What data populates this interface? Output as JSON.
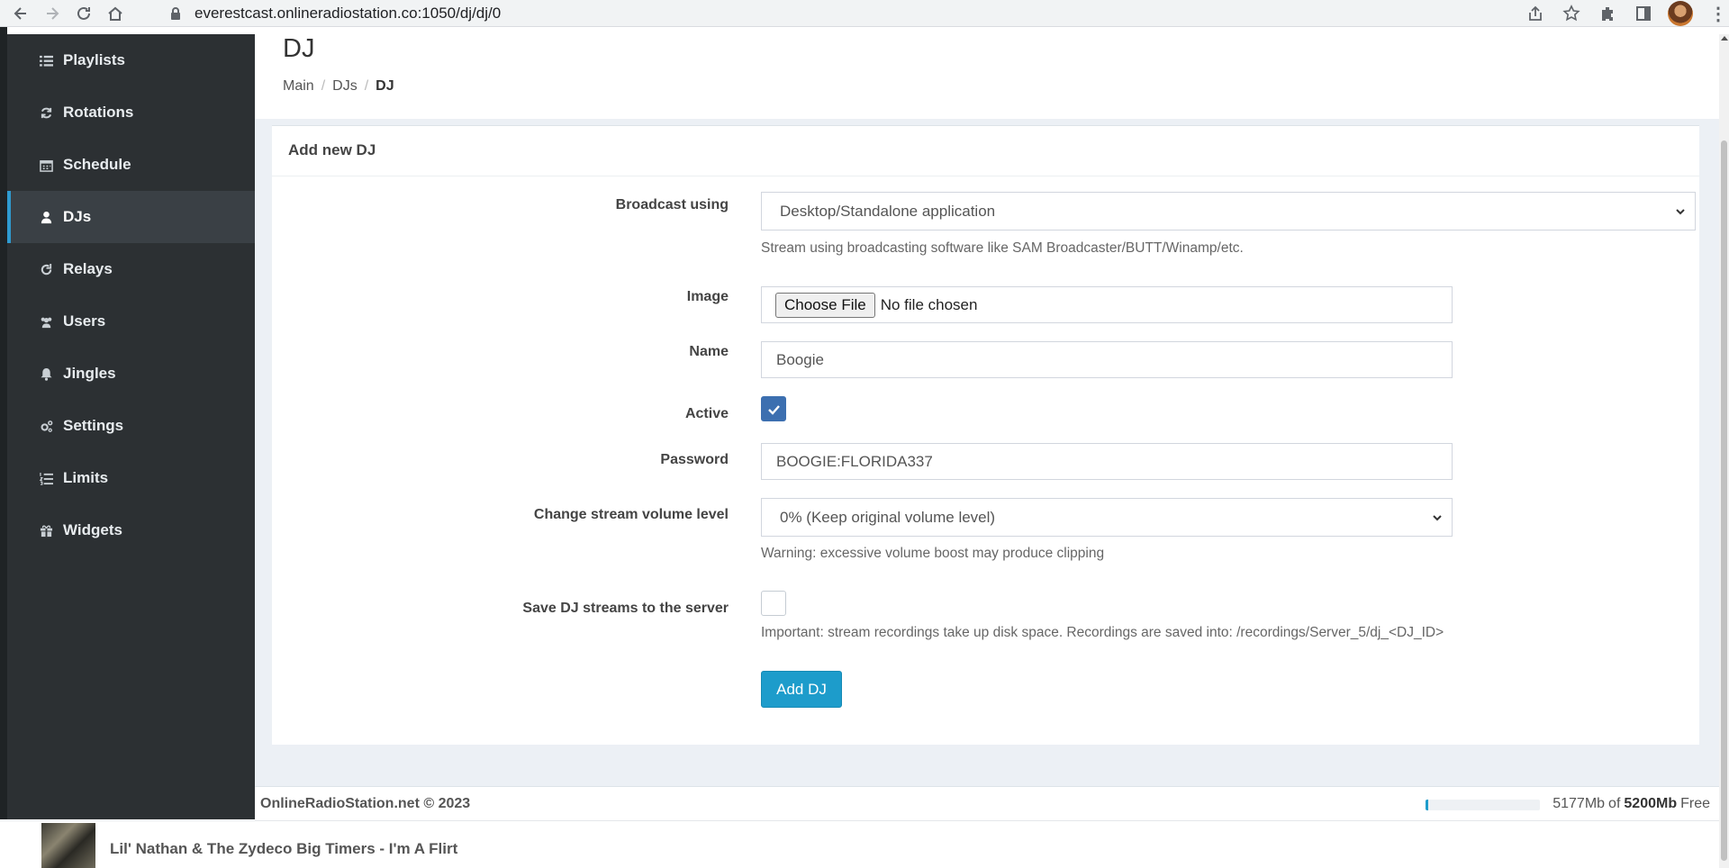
{
  "browser": {
    "url": "everestcast.onlineradiostation.co:1050/dj/dj/0"
  },
  "sidebar": {
    "items": [
      {
        "label": "Playlists",
        "icon": "list-icon"
      },
      {
        "label": "Rotations",
        "icon": "refresh-icon"
      },
      {
        "label": "Schedule",
        "icon": "calendar-icon"
      },
      {
        "label": "DJs",
        "icon": "user-icon",
        "active": true
      },
      {
        "label": "Relays",
        "icon": "redo-icon"
      },
      {
        "label": "Users",
        "icon": "users-icon"
      },
      {
        "label": "Jingles",
        "icon": "bell-icon"
      },
      {
        "label": "Settings",
        "icon": "cogs-icon"
      },
      {
        "label": "Limits",
        "icon": "list-ol-icon"
      },
      {
        "label": "Widgets",
        "icon": "gift-icon"
      }
    ]
  },
  "header": {
    "title": "DJ",
    "breadcrumb": [
      "Main",
      "DJs",
      "DJ"
    ]
  },
  "form": {
    "title": "Add new DJ",
    "broadcast": {
      "label": "Broadcast using",
      "value": "Desktop/Standalone application",
      "help": "Stream using broadcasting software like SAM Broadcaster/BUTT/Winamp/etc."
    },
    "image": {
      "label": "Image",
      "button": "Choose File",
      "status": "No file chosen"
    },
    "name": {
      "label": "Name",
      "value": "Boogie"
    },
    "active": {
      "label": "Active",
      "checked": true
    },
    "password": {
      "label": "Password",
      "value": "BOOGIE:FLORIDA337"
    },
    "volume": {
      "label": "Change stream volume level",
      "value": "0% (Keep original volume level)",
      "help": "Warning: excessive volume boost may produce clipping"
    },
    "save_streams": {
      "label": "Save DJ streams to the server",
      "checked": false,
      "help": "Important: stream recordings take up disk space. Recordings are saved into: /recordings/Server_5/dj_<DJ_ID>"
    },
    "submit_label": "Add DJ"
  },
  "footer": {
    "copyright": "OnlineRadioStation.net © 2023",
    "disk_used": "5177Mb",
    "disk_of": "of",
    "disk_total": "5200Mb",
    "disk_free": "Free",
    "disk_usage_fraction": 0.02
  },
  "player": {
    "track": "Lil' Nathan & The Zydeco Big Timers - I'm A Flirt"
  },
  "colors": {
    "sidebar_bg": "#2c3033",
    "accent": "#1d9ccb",
    "checkbox_checked": "#3c6fb0"
  }
}
